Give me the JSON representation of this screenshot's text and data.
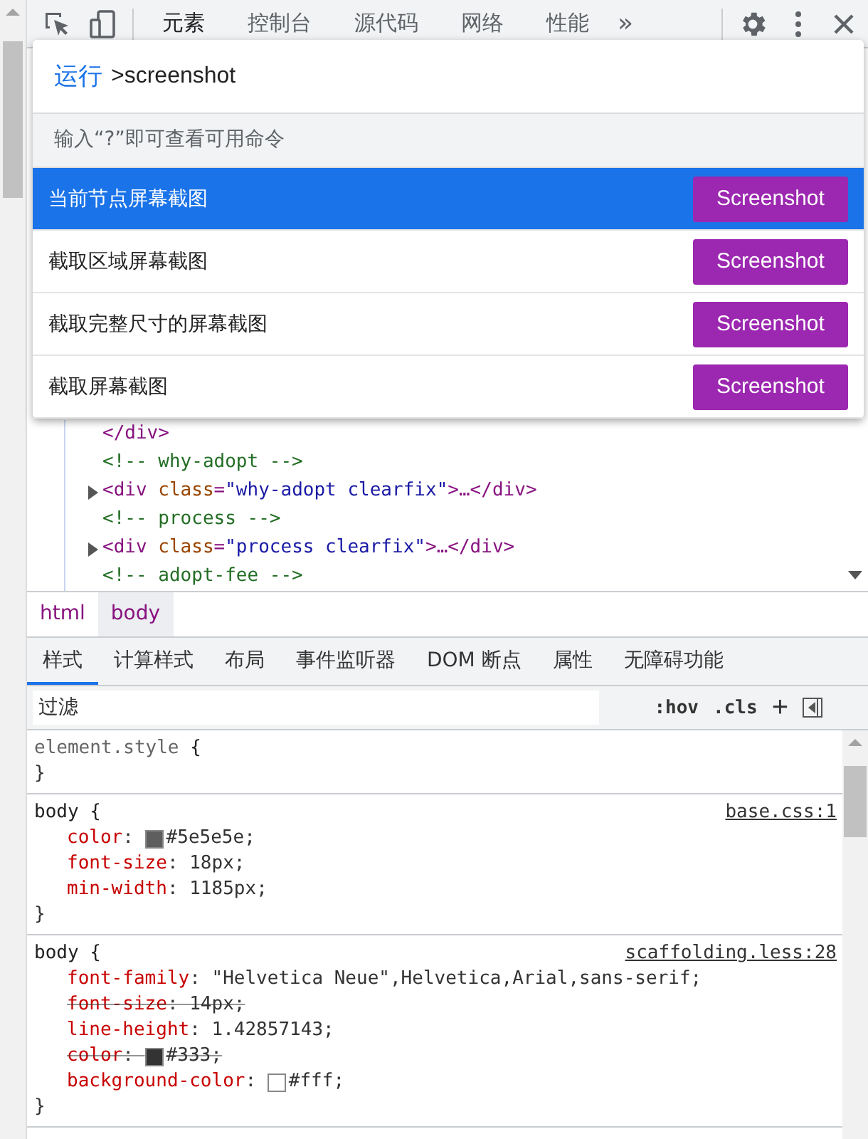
{
  "toolbar": {
    "tabs": [
      {
        "label": "元素",
        "selected": true
      },
      {
        "label": "控制台",
        "selected": false
      },
      {
        "label": "源代码",
        "selected": false
      },
      {
        "label": "网络",
        "selected": false
      },
      {
        "label": "性能",
        "selected": false
      }
    ],
    "more": "»"
  },
  "command_menu": {
    "prefix": "运行",
    "value": ">screenshot",
    "hint": "输入“?”即可查看可用命令",
    "items": [
      {
        "label": "当前节点屏幕截图",
        "button": "Screenshot",
        "selected": true
      },
      {
        "label": "截取区域屏幕截图",
        "button": "Screenshot",
        "selected": false
      },
      {
        "label": "截取完整尺寸的屏幕截图",
        "button": "Screenshot",
        "selected": false
      },
      {
        "label": "截取屏幕截图",
        "button": "Screenshot",
        "selected": false
      }
    ]
  },
  "dom_tree": [
    {
      "expandable": false,
      "segments": [
        {
          "kind": "tag",
          "text": "</div>"
        }
      ]
    },
    {
      "expandable": false,
      "segments": [
        {
          "kind": "comment",
          "text": "<!-- why-adopt -->"
        }
      ]
    },
    {
      "expandable": true,
      "segments": [
        {
          "kind": "tag",
          "text": "<div"
        },
        {
          "kind": "attr",
          "text": "class"
        },
        {
          "kind": "tag",
          "text": "="
        },
        {
          "kind": "value",
          "text": "\"why-adopt clearfix\""
        },
        {
          "kind": "tag",
          "text": ">…</div>"
        }
      ]
    },
    {
      "expandable": false,
      "segments": [
        {
          "kind": "comment",
          "text": "<!-- process -->"
        }
      ]
    },
    {
      "expandable": true,
      "segments": [
        {
          "kind": "tag",
          "text": "<div"
        },
        {
          "kind": "attr",
          "text": "class"
        },
        {
          "kind": "tag",
          "text": "="
        },
        {
          "kind": "value",
          "text": "\"process clearfix\""
        },
        {
          "kind": "tag",
          "text": ">…</div>"
        }
      ]
    },
    {
      "expandable": false,
      "segments": [
        {
          "kind": "comment",
          "text": "<!-- adopt-fee -->"
        }
      ]
    }
  ],
  "breadcrumbs": [
    {
      "label": "html",
      "selected": false
    },
    {
      "label": "body",
      "selected": true
    }
  ],
  "style_tabs": [
    {
      "label": "样式",
      "selected": true
    },
    {
      "label": "计算样式",
      "selected": false
    },
    {
      "label": "布局",
      "selected": false
    },
    {
      "label": "事件监听器",
      "selected": false
    },
    {
      "label": "DOM 断点",
      "selected": false
    },
    {
      "label": "属性",
      "selected": false
    },
    {
      "label": "无障碍功能",
      "selected": false
    }
  ],
  "filter": {
    "placeholder": "过滤",
    "hov": ":hov",
    "cls": ".cls",
    "plus": "+"
  },
  "rules": [
    {
      "selector": "element.style",
      "open": "{",
      "close": "}"
    },
    {
      "selector": "body",
      "open": "{",
      "close": "}",
      "source": "base.css:1",
      "declarations": [
        {
          "property": "color",
          "colon": ":",
          "value": "#5e5e5e;",
          "color": "#5e5e5e",
          "struck": false
        },
        {
          "property": "font-size",
          "colon": ":",
          "value": "18px;",
          "struck": false
        },
        {
          "property": "min-width",
          "colon": ":",
          "value": "1185px;",
          "struck": false
        }
      ]
    },
    {
      "selector": "body",
      "open": "{",
      "close": "}",
      "source": "scaffolding.less:28",
      "declarations": [
        {
          "property": "font-family",
          "colon": ":",
          "value": "\"Helvetica Neue\",Helvetica,Arial,sans-serif;",
          "struck": false
        },
        {
          "property": "font-size",
          "colon": ":",
          "value": "14px;",
          "struck": true
        },
        {
          "property": "line-height",
          "colon": ":",
          "value": "1.42857143;",
          "struck": false
        },
        {
          "property": "color",
          "colon": ":",
          "value": "#333;",
          "color": "#333333",
          "struck": true
        },
        {
          "property": "background-color",
          "colon": ":",
          "value": "#fff;",
          "color": "#ffffff",
          "struck": false
        }
      ]
    }
  ]
}
